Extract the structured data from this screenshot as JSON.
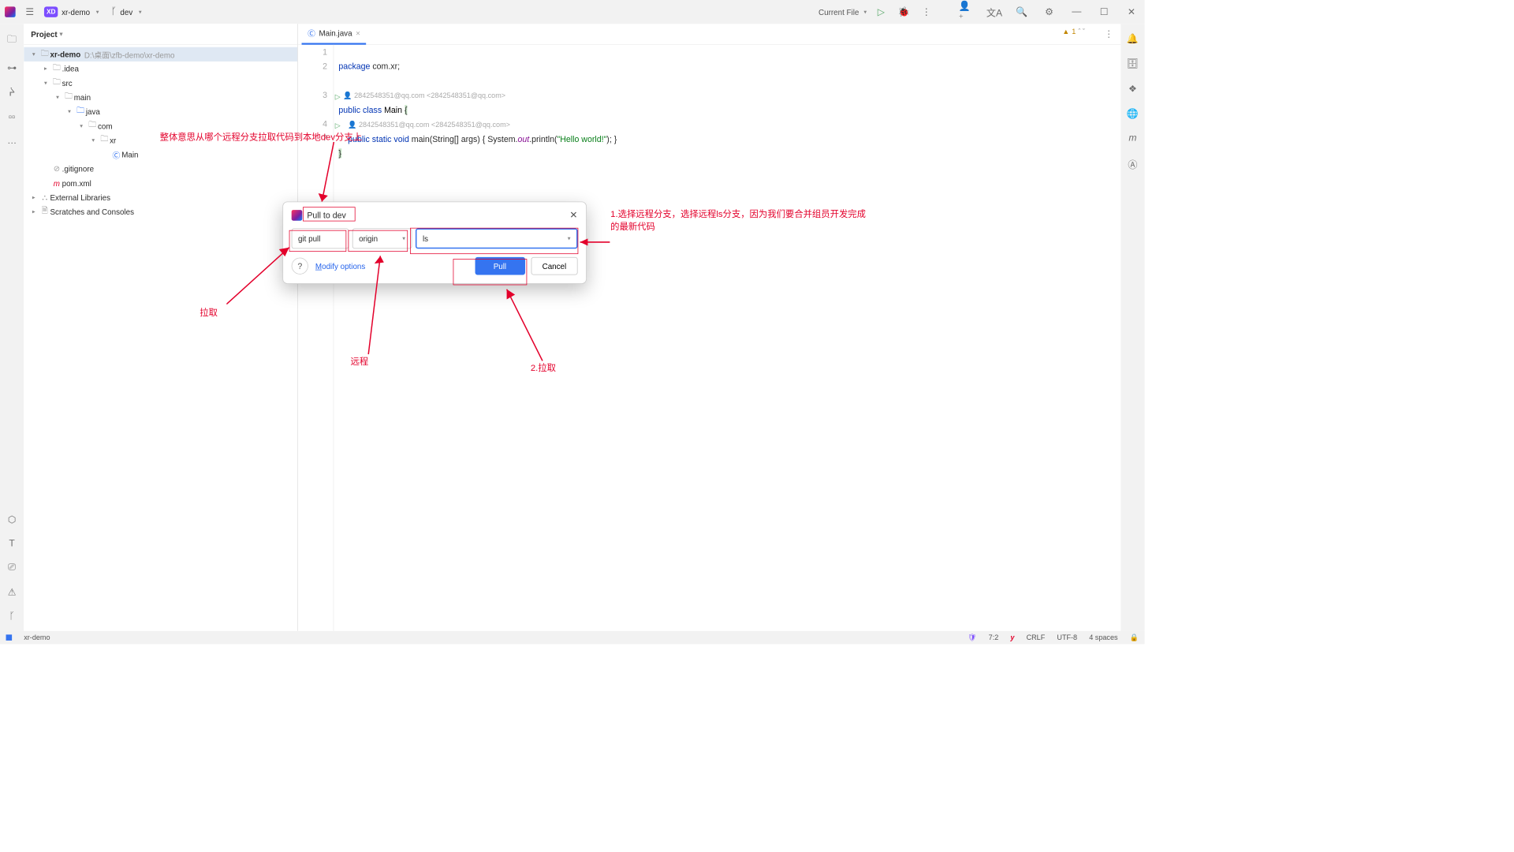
{
  "titlebar": {
    "project": "xr-demo",
    "branch": "dev",
    "run_config": "Current File"
  },
  "project_panel": {
    "title": "Project",
    "root_name": "xr-demo",
    "root_path": "D:\\桌面\\zfb-demo\\xr-demo",
    "idea": ".idea",
    "src": "src",
    "main": "main",
    "java": "java",
    "com": "com",
    "xr": "xr",
    "Main": "Main",
    "gitignore": ".gitignore",
    "pom": "pom.xml",
    "ext_lib": "External Libraries",
    "scratches": "Scratches and Consoles"
  },
  "editor": {
    "tab": "Main.java",
    "warnings": "1",
    "l1": "package com.xr;",
    "hint1": "2842548351@qq.com <2842548351@qq.com>",
    "l3_kw": "public class ",
    "l3_name": "Main ",
    "l3_brace": "{",
    "hint2": "2842548351@qq.com <2842548351@qq.com>",
    "l4_pre": "    ",
    "l4_kw": "public static void ",
    "l4_name": "main",
    "l4_p1": "(String[] args) { System.",
    "l4_out": "out",
    "l4_p2": ".println(",
    "l4_str": "\"Hello world!\"",
    "l4_p3": "); }",
    "l5": "}"
  },
  "dialog": {
    "title": "Pull to dev",
    "git_pull": "git pull",
    "remote": "origin",
    "branch": "ls",
    "modify": "Modify options",
    "mod_u": "M",
    "pull_btn": "Pull",
    "cancel_btn": "Cancel"
  },
  "annotations": {
    "top": "整体意思从哪个远程分支拉取代码到本地dev分支上",
    "right1": "1.选择远程分支，选择远程ls分支，因为我们要合并组员开发完成的最新代码",
    "pull_label": "拉取",
    "remote_label": "远程",
    "step2": "2.拉取"
  },
  "status": {
    "module": "xr-demo",
    "pos": "7:2",
    "crlf": "CRLF",
    "enc": "UTF-8",
    "indent": "4 spaces"
  }
}
